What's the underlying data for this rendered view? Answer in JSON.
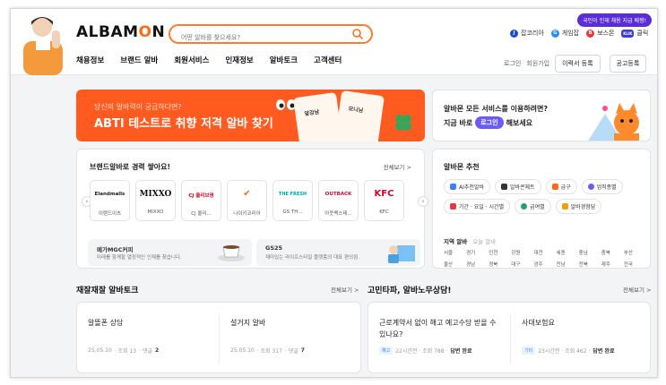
{
  "header": {
    "logo_prefix": "ALBAM",
    "logo_o": "O",
    "logo_suffix": "N",
    "search_placeholder": "어떤 알바를 찾으세요?",
    "top_badge": "국민이 인재 채용 지급 배짱!",
    "partners": [
      {
        "label": "잡코리아",
        "icon": "J",
        "color": "#1f4ad6"
      },
      {
        "label": "게임잡",
        "icon": "G",
        "color": "#2c8df4"
      },
      {
        "label": "보스몬",
        "icon": "B",
        "color": "#e23b3b"
      },
      {
        "label": "클릭",
        "icon": "KLIK",
        "color": "#3b3bd6"
      }
    ],
    "nav": [
      "채용정보",
      "브랜드 알바",
      "회원서비스",
      "인재정보",
      "알바토크",
      "고객센터"
    ],
    "util": {
      "login": "로그인",
      "signup": "회원가입",
      "resume": "이력서 등록",
      "post_job": "공고등록"
    }
  },
  "banner": {
    "subtitle": "당신의 알바력이 궁금하다면?",
    "title": "ABTI 테스트로 취향 저격 알바 찾기",
    "card1": "앞강남",
    "card2": "모니님"
  },
  "login_box": {
    "line1": "알바몬 모든 서비스를 이용하려면?",
    "line2_prefix": "지금 바로",
    "login_pill": "로그인",
    "line2_suffix": "해보세요"
  },
  "brand_section": {
    "title": "브랜드알바로 경력 쌓아요!",
    "see_all": "전체보기 >",
    "brands": [
      {
        "logo": "Elandmalls",
        "name": "이랜드이츠",
        "color": "#1a1a1a"
      },
      {
        "logo": "MIXXO",
        "name": "MIXXO",
        "color": "#111111"
      },
      {
        "logo": "CJ 올리브영",
        "name": "CJ 올리...",
        "color": "#e1001e"
      },
      {
        "logo": "✔",
        "name": "나이키코리아",
        "color": "#ff6a13"
      },
      {
        "logo": "THE FRESH",
        "name": "GS TH...",
        "color": "#00a6a6"
      },
      {
        "logo": "OUTBACK",
        "name": "아웃백스테...",
        "color": "#c8102e"
      },
      {
        "logo": "KFC",
        "name": "KFC",
        "color": "#d8002a"
      }
    ],
    "promos": [
      {
        "title": "메가MGC커피",
        "desc": "미래를 함께할 열정적인 인재를 찾습니다."
      },
      {
        "title": "GS25",
        "desc": "재미있는 라이프스타일 플랫폼의 대표 편의점."
      }
    ]
  },
  "recommend": {
    "title": "알바몬 추천",
    "tags": [
      {
        "label": "AI추천알바",
        "color": "#3b82f6"
      },
      {
        "label": "알바콘체트",
        "color": "#333333"
      },
      {
        "label": "급구",
        "color": "#ff6a13"
      },
      {
        "label": "업직종별",
        "color": "#6b5cf6"
      },
      {
        "label": "기간 · 요일 · 시간별",
        "color": "#e23b3b"
      },
      {
        "label": "급여별",
        "color": "#22a06b"
      },
      {
        "label": "알바경험담",
        "color": "#f59e0b"
      }
    ],
    "region_tab_on": "지역 알바",
    "region_tab_off": "오늘 알바",
    "regions": [
      "서울",
      "경기",
      "인천",
      "강원",
      "대전",
      "세종",
      "충남",
      "충북",
      "부산",
      "울산",
      "경남",
      "경북",
      "대구",
      "광주",
      "전남",
      "전북",
      "제주",
      "전국"
    ]
  },
  "talk": {
    "title": "재잘재잘 알바토크",
    "see_all": "전체보기 >",
    "posts": [
      {
        "title": "알뜰폰 상담",
        "date": "25.05.10",
        "views": "· 조회 13",
        "comments_label": "· 댓글",
        "comments": "2"
      },
      {
        "title": "설거지 알바",
        "date": "25.05.10",
        "views": "· 조회 317",
        "comments_label": "· 댓글",
        "comments": "7"
      }
    ]
  },
  "consult": {
    "title": "고민타파, 알바노무상담!",
    "see_all": "전체보기 >",
    "posts": [
      {
        "title": "근로계약서 없이 해고 예고수당 받을 수 있나요?",
        "tag": "해고",
        "time": "22시간전 · 조회 788 ·",
        "status": "답변 완료"
      },
      {
        "title": "사대보험요",
        "tag": "기타",
        "time": "23시간전 · 조회 462 ·",
        "status": "답변 완료"
      }
    ]
  },
  "colors": {
    "accent": "#ff6a13",
    "banner": "#ff5a1f",
    "login_pill": "#6b5cf6"
  }
}
